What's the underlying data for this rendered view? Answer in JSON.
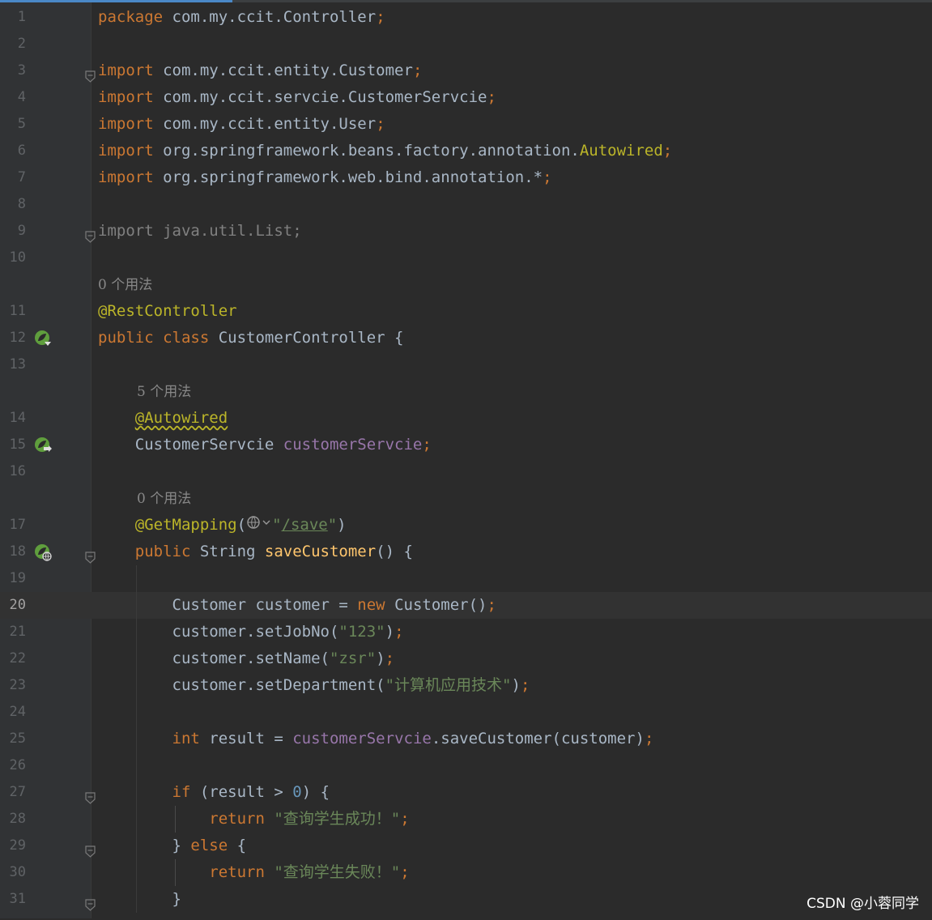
{
  "editor": {
    "lines": [
      {
        "n": "1",
        "parts": [
          [
            "kw",
            "package"
          ],
          [
            "pk",
            " com.my.ccit.Controller"
          ],
          [
            "kw",
            ";"
          ]
        ]
      },
      {
        "n": "2",
        "parts": []
      },
      {
        "n": "3",
        "fold": true,
        "parts": [
          [
            "kw",
            "import"
          ],
          [
            "pk",
            " com.my.ccit.entity.Customer"
          ],
          [
            "kw",
            ";"
          ]
        ]
      },
      {
        "n": "4",
        "parts": [
          [
            "kw",
            "import"
          ],
          [
            "pk",
            " com.my.ccit.servcie.CustomerServcie"
          ],
          [
            "kw",
            ";"
          ]
        ]
      },
      {
        "n": "5",
        "parts": [
          [
            "kw",
            "import"
          ],
          [
            "pk",
            " com.my.ccit.entity.User"
          ],
          [
            "kw",
            ";"
          ]
        ]
      },
      {
        "n": "6",
        "parts": [
          [
            "kw",
            "import"
          ],
          [
            "pk",
            " org.springframework.beans.factory.annotation."
          ],
          [
            "cls-ann",
            "Autowired"
          ],
          [
            "kw",
            ";"
          ]
        ]
      },
      {
        "n": "7",
        "parts": [
          [
            "kw",
            "import"
          ],
          [
            "pk",
            " org.springframework.web.bind.annotation.*"
          ],
          [
            "kw",
            ";"
          ]
        ]
      },
      {
        "n": "8",
        "parts": []
      },
      {
        "n": "9",
        "fold": true,
        "parts": [
          [
            "dim",
            "import java.util.List;"
          ]
        ]
      },
      {
        "n": "10",
        "parts": []
      },
      {
        "n": "",
        "hint": "0 个用法",
        "indent": 0
      },
      {
        "n": "11",
        "parts": [
          [
            "ann",
            "@RestController"
          ]
        ]
      },
      {
        "n": "12",
        "icon": "spring-bean-icon",
        "parts": [
          [
            "kw",
            "public class "
          ],
          [
            "pk",
            "CustomerController {"
          ]
        ]
      },
      {
        "n": "13",
        "parts": []
      },
      {
        "n": "",
        "hint": "5 个用法",
        "indent": 1
      },
      {
        "n": "14",
        "parts": [
          [
            "pk",
            "    "
          ],
          [
            "ann squig",
            "@Autowired"
          ]
        ]
      },
      {
        "n": "15",
        "icon": "spring-inject-icon",
        "parts": [
          [
            "pk",
            "    CustomerServcie "
          ],
          [
            "fld",
            "customerServcie"
          ],
          [
            "kw",
            ";"
          ]
        ]
      },
      {
        "n": "16",
        "parts": []
      },
      {
        "n": "",
        "hint": "0 个用法",
        "indent": 1
      },
      {
        "n": "17",
        "parts": [
          [
            "pk",
            "    "
          ],
          [
            "ann",
            "@GetMapping"
          ],
          [
            "pk",
            "("
          ],
          [
            "globe",
            ""
          ],
          [
            "str",
            "\""
          ],
          [
            "lnk",
            "/save"
          ],
          [
            "str",
            "\""
          ],
          [
            "pk",
            ")"
          ]
        ]
      },
      {
        "n": "18",
        "icon": "spring-web-icon",
        "fold": true,
        "parts": [
          [
            "kw",
            "    public "
          ],
          [
            "pk",
            "String "
          ],
          [
            "mth",
            "saveCustomer"
          ],
          [
            "pk",
            "() {"
          ]
        ]
      },
      {
        "n": "19",
        "parts": []
      },
      {
        "n": "20",
        "current": true,
        "parts": [
          [
            "pk",
            "        Customer customer = "
          ],
          [
            "kw",
            "new "
          ],
          [
            "pk",
            "Customer()"
          ],
          [
            "kw",
            ";"
          ]
        ]
      },
      {
        "n": "21",
        "parts": [
          [
            "pk",
            "        customer.setJobNo("
          ],
          [
            "str",
            "\"123\""
          ],
          [
            "pk",
            ")"
          ],
          [
            "kw",
            ";"
          ]
        ]
      },
      {
        "n": "22",
        "parts": [
          [
            "pk",
            "        customer.setName("
          ],
          [
            "str",
            "\"zsr\""
          ],
          [
            "pk",
            ")"
          ],
          [
            "kw",
            ";"
          ]
        ]
      },
      {
        "n": "23",
        "parts": [
          [
            "pk",
            "        customer.setDepartment("
          ],
          [
            "str",
            "\"计算机应用技术\""
          ],
          [
            "pk",
            ")"
          ],
          [
            "kw",
            ";"
          ]
        ]
      },
      {
        "n": "24",
        "parts": []
      },
      {
        "n": "25",
        "parts": [
          [
            "kw",
            "        int "
          ],
          [
            "pk",
            "result = "
          ],
          [
            "fld",
            "customerServcie"
          ],
          [
            "pk",
            ".saveCustomer(customer)"
          ],
          [
            "kw",
            ";"
          ]
        ]
      },
      {
        "n": "26",
        "parts": []
      },
      {
        "n": "27",
        "fold": true,
        "parts": [
          [
            "kw",
            "        if "
          ],
          [
            "pk",
            "(result > "
          ],
          [
            "num",
            "0"
          ],
          [
            "pk",
            ") {"
          ]
        ]
      },
      {
        "n": "28",
        "parts": [
          [
            "kw",
            "            return "
          ],
          [
            "str",
            "\"查询学生成功！\""
          ],
          [
            "kw",
            ";"
          ]
        ]
      },
      {
        "n": "29",
        "fold": true,
        "parts": [
          [
            "pk",
            "        } "
          ],
          [
            "kw",
            "else "
          ],
          [
            "pk",
            "{"
          ]
        ]
      },
      {
        "n": "30",
        "parts": [
          [
            "kw",
            "            return "
          ],
          [
            "str",
            "\"查询学生失败！\""
          ],
          [
            "kw",
            ";"
          ]
        ]
      },
      {
        "n": "31",
        "fold": true,
        "parts": [
          [
            "pk",
            "        }"
          ]
        ]
      }
    ]
  },
  "watermark": "CSDN @小蓉同学",
  "colors": {
    "background": "#2b2b2b",
    "gutter": "#313335",
    "keyword": "#cc7832",
    "annotation": "#bbb529",
    "string": "#6a8759",
    "field": "#9876aa",
    "method": "#ffc66d",
    "number": "#6897bb",
    "text": "#a9b7c6"
  }
}
